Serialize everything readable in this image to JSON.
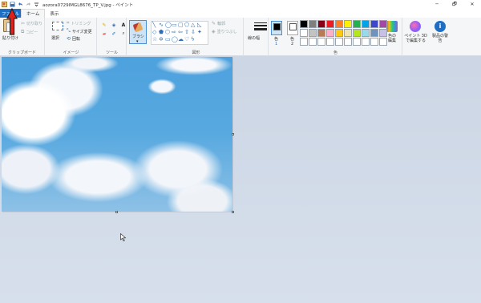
{
  "window": {
    "title": "aozora0729IMGL8676_TP_V.jpg - ペイント",
    "minimize": "─",
    "maximize": "🗗",
    "close": "✕"
  },
  "tabs": [
    {
      "label": "ファイル"
    },
    {
      "label": "ホーム"
    },
    {
      "label": "表示"
    }
  ],
  "clipboard": {
    "paste": "貼り付け",
    "cut": "切り取り",
    "copy": "コピー",
    "group": "クリップボード"
  },
  "image": {
    "select": "選択",
    "crop": "トリミング",
    "resize": "サイズ変更",
    "rotate": "回転",
    "group": "イメージ"
  },
  "tools": {
    "group": "ツール",
    "text_tool": "A"
  },
  "brush": {
    "label": "ブラシ"
  },
  "shapes": {
    "outline": "輪郭",
    "fill": "塗りつぶし",
    "group": "図形"
  },
  "size": {
    "label": "線の幅"
  },
  "colors": {
    "color1": "色",
    "color1_num": "1",
    "color2": "色",
    "color2_num": "2",
    "edit": "色の編集",
    "group": "色",
    "color1_value": "#000000",
    "color2_value": "#ffffff",
    "palette": [
      "#000000",
      "#7f7f7f",
      "#880015",
      "#ed1c24",
      "#ff7f27",
      "#fff200",
      "#22b14c",
      "#00a2e8",
      "#3f48cc",
      "#a349a4",
      "#ffffff",
      "#c3c3c3",
      "#b97a57",
      "#ffaec9",
      "#ffc90e",
      "#efe4b0",
      "#b5e61d",
      "#99d9ea",
      "#7092be",
      "#c8bfe7",
      "#ffffff",
      "#ffffff",
      "#ffffff",
      "#ffffff",
      "#ffffff",
      "#ffffff",
      "#ffffff",
      "#ffffff",
      "#ffffff",
      "#ffffff"
    ]
  },
  "paint3d": {
    "label": "ペイント 3D で編集する"
  },
  "product_alert": {
    "label": "製品の警告"
  }
}
